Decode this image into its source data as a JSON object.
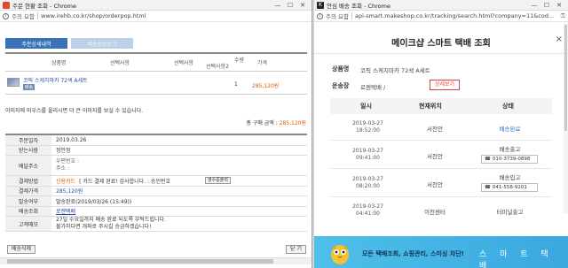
{
  "left": {
    "window_title": "주문 현황 조회 - Chrome",
    "security_label": "주의 요함",
    "url": "www.irehb.co.kr/shop/orderpop.html",
    "tabs": {
      "active": "주문상세내역",
      "inactive": "배송정보보기"
    },
    "option_headers": [
      "상품명",
      "선택사항",
      "선택사항",
      "선택사항2",
      "수량",
      "가격"
    ],
    "product": {
      "name": "코픽 스케치마카 72색 A세트",
      "badge": "배송",
      "qty": "1",
      "price": "285,120원"
    },
    "notice": "이미지에 마우스를 올리시면 더 큰 이미지를 보실 수 있습니다.",
    "total_label": "총 구매 금액 :",
    "total_value": "285,120원",
    "rows": {
      "order_date": {
        "label": "주문일자",
        "value": "2019.03.26"
      },
      "receiver": {
        "label": "받는사람",
        "value": "정안정"
      },
      "address": {
        "label": "배달주소",
        "line1": "우편번호 :",
        "line2": "주소 :"
      },
      "payment": {
        "label": "결제방법",
        "method": "신용카드",
        "detail": "[ 카드 결제 완료! 감사합니다. : 승인번호",
        "receipt": "영수증출력"
      },
      "amount": {
        "label": "결제가격",
        "value": "285,120원"
      },
      "shipping_status": {
        "label": "발송여부",
        "value": "발송완료(2019/03/26 (15:49))"
      },
      "courier": {
        "label": "배송조회",
        "value": "로젠택배"
      },
      "memo": {
        "label": "고객메모",
        "line1": "27일 수요일까지 배송 완료 되도록 부탁드립니다.",
        "line2": "불가하다면 개파로 주시길 승금하겠습니다!"
      }
    },
    "buttons": {
      "cancel": "배송삭제",
      "close": "닫 기"
    }
  },
  "right": {
    "window_title": "안심 배송 조회 - Chrome",
    "security_label": "주의 요함",
    "url": "api-smart.makeshop.co.kr/tracking/search.html?company=11&cod...",
    "page_title": "메이크샵 스마트 택배 조회",
    "close_icon": "×",
    "product_label": "상품명",
    "product_value": "코픽 스케치마카 72색 A세트",
    "courier_label": "운송장",
    "courier_value": "로젠택배 /",
    "detail_button": "상세보기",
    "track_headers": {
      "date": "일시",
      "location": "현재위치",
      "status": "상태"
    },
    "tracking": [
      {
        "date": "2019-03-27",
        "time": "18:52:00",
        "location": "서천안",
        "status": "배송완료",
        "phone": ""
      },
      {
        "date": "2019-03-27",
        "time": "09:41:00",
        "location": "서천안",
        "status": "배송출고",
        "phone": "010-3739-0898"
      },
      {
        "date": "2019-03-27",
        "time": "08:20:00",
        "location": "서천안",
        "status": "배송입고",
        "phone": "041-558-9201"
      },
      {
        "date": "2019-03-27",
        "time": "04:41:00",
        "location": "이천센터",
        "status": "터미널출고",
        "phone": ""
      }
    ],
    "banner": {
      "message": "모든 택배조회, 쇼핑관리, 스미싱 차단!",
      "brand": "스 마 트 택 배"
    }
  },
  "colors": {
    "accent_blue": "#3a72b8",
    "price_orange": "#e05a00",
    "link_blue": "#2a4d9b",
    "alert_red": "#e04040",
    "banner_blue": "#4ec0ea"
  }
}
